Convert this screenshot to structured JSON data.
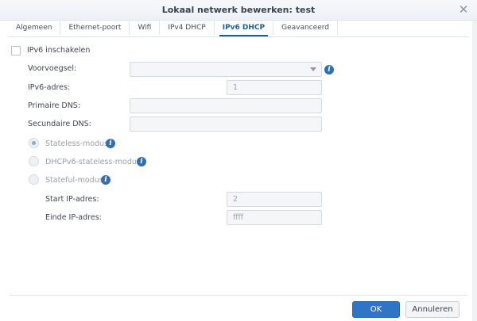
{
  "window": {
    "title": "Lokaal netwerk bewerken: test"
  },
  "tabs": [
    {
      "label": "Algemeen"
    },
    {
      "label": "Ethernet-poort"
    },
    {
      "label": "Wifi"
    },
    {
      "label": "IPv4 DHCP"
    },
    {
      "label": "IPv6 DHCP",
      "active": true
    },
    {
      "label": "Geavanceerd"
    }
  ],
  "form": {
    "enable_ipv6": {
      "label": "IPv6 inschakelen",
      "checked": false
    },
    "prefix": {
      "label": "Voorvoegsel:",
      "value": ""
    },
    "ipv6_address": {
      "label": "IPv6-adres:",
      "value": "1"
    },
    "primary_dns": {
      "label": "Primaire DNS:",
      "value": ""
    },
    "secondary_dns": {
      "label": "Secundaire DNS:",
      "value": ""
    },
    "modes": [
      {
        "label": "Stateless-modus",
        "selected": true
      },
      {
        "label": "DHCPv6-stateless-modus",
        "selected": false
      },
      {
        "label": "Stateful-modus",
        "selected": false
      }
    ],
    "start_ip": {
      "label": "Start IP-adres:",
      "value": "2"
    },
    "end_ip": {
      "label": "Einde IP-adres:",
      "value": "ffff"
    }
  },
  "buttons": {
    "ok": "OK",
    "cancel": "Annuleren"
  },
  "colors": {
    "accent": "#2f74c7",
    "tab_active": "#1b5ea8",
    "info_icon": "#2f6fb6"
  }
}
